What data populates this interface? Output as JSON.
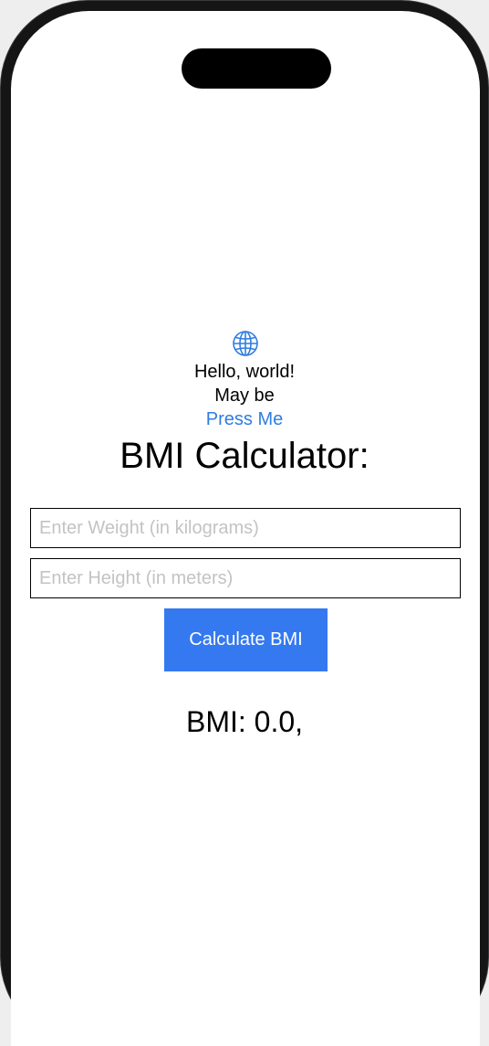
{
  "header": {
    "icon": "globe-icon",
    "greeting": "Hello, world!",
    "subtitle": "May be",
    "link_label": "Press Me",
    "link_color": "#2f7de1"
  },
  "calculator": {
    "title": "BMI Calculator:",
    "weight_placeholder": "Enter Weight (in kilograms)",
    "weight_value": "",
    "height_placeholder": "Enter Height (in meters)",
    "height_value": "",
    "button_label": "Calculate BMI",
    "button_color": "#3479f0",
    "result_text": "BMI: 0.0,"
  }
}
